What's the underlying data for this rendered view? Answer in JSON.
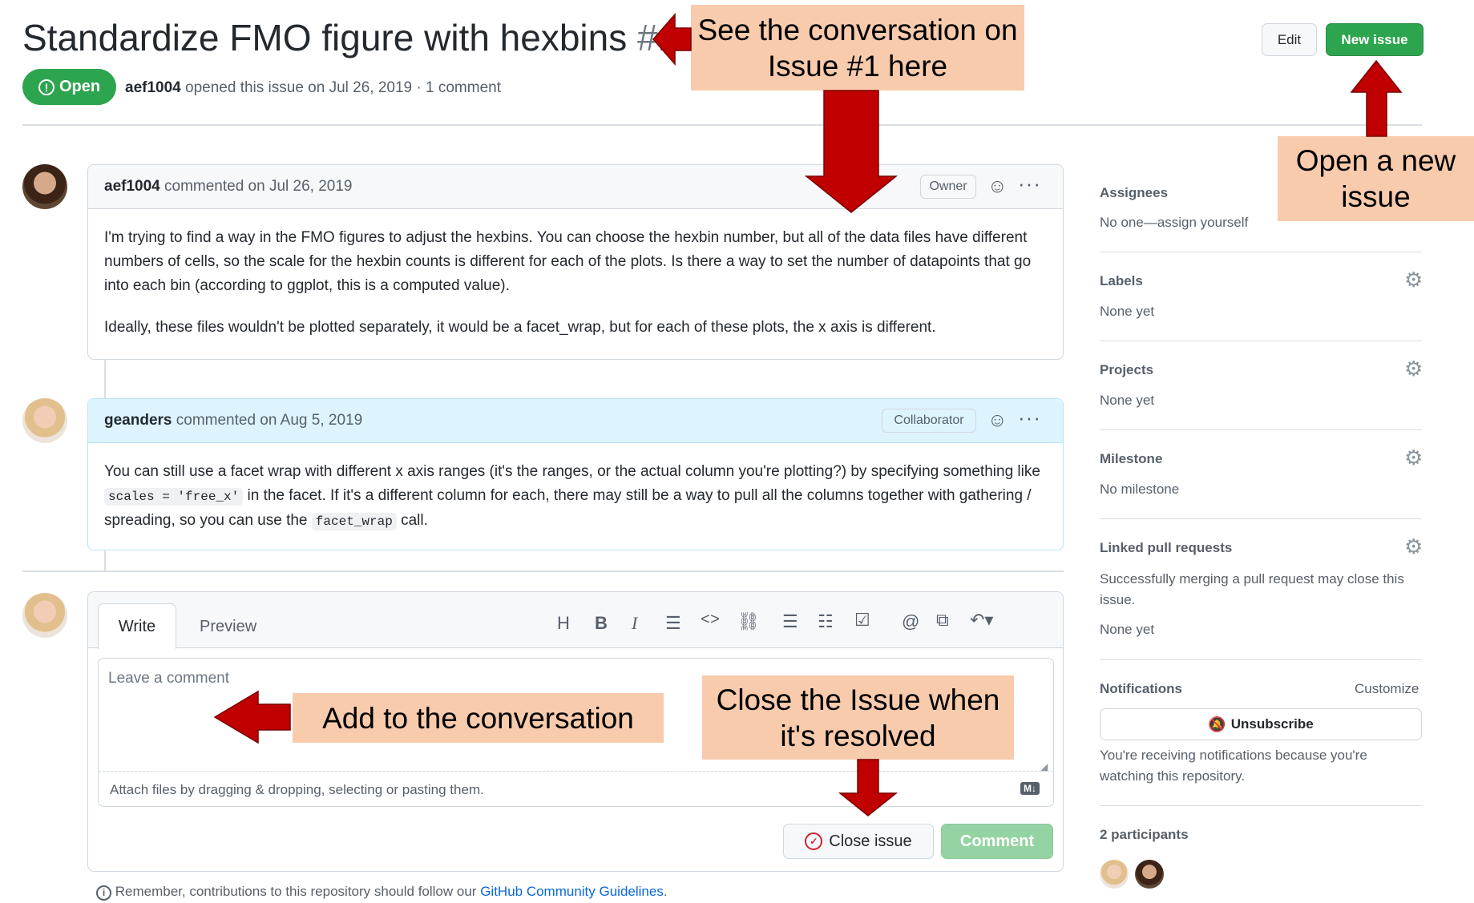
{
  "issue": {
    "title": "Standardize FMO figure with hexbins",
    "number": "#1",
    "status": "Open",
    "author": "aef1004",
    "opened_text": "opened this issue on Jul 26, 2019 · 1 comment"
  },
  "header_buttons": {
    "edit": "Edit",
    "new_issue": "New issue"
  },
  "comments": [
    {
      "author": "aef1004",
      "date_text": "commented on Jul 26, 2019",
      "role": "Owner",
      "paragraphs": [
        "I'm trying to find a way in the FMO figures to adjust the hexbins. You can choose the hexbin number, but all of the data files have different numbers of cells, so the scale for the hexbin counts is different for each of the plots. Is there a way to set the number of datapoints that go into each bin (according to ggplot, this is a computed value).",
        "Ideally, these files wouldn't be plotted separately, it would be a facet_wrap, but for each of these plots, the x axis is different."
      ]
    },
    {
      "author": "geanders",
      "date_text": "commented on Aug 5, 2019",
      "role": "Collaborator",
      "text_1": "You can still use a facet wrap with different x axis ranges (it's the ranges, or the actual column you're plotting?) by specifying something like",
      "code_1": "scales = 'free_x'",
      "text_2": "in the facet. If it's a different column for each, there may still be a way to pull all the columns together with gathering / spreading, so you can use the",
      "code_2": "facet_wrap",
      "text_3": "call."
    }
  ],
  "editor": {
    "tab_write": "Write",
    "tab_preview": "Preview",
    "toolbar": [
      "H",
      "B",
      "I",
      "quote",
      "code",
      "link",
      "bulleted-list",
      "numbered-list",
      "task-list",
      "mention",
      "reference",
      "reply"
    ],
    "placeholder": "Leave a comment",
    "attach_text": "Attach files by dragging & dropping, selecting or pasting them.",
    "close_button": "Close issue",
    "comment_button": "Comment",
    "guidelines_prefix": "Remember, contributions to this repository should follow our",
    "guidelines_link": "GitHub Community Guidelines",
    "guidelines_suffix": "."
  },
  "sidebar": {
    "assignees": {
      "heading": "Assignees",
      "value": "No one—assign yourself"
    },
    "labels": {
      "heading": "Labels",
      "value": "None yet"
    },
    "projects": {
      "heading": "Projects",
      "value": "None yet"
    },
    "milestone": {
      "heading": "Milestone",
      "value": "No milestone"
    },
    "linked_prs": {
      "heading": "Linked pull requests",
      "description": "Successfully merging a pull request may close this issue.",
      "value": "None yet"
    },
    "notifications": {
      "heading": "Notifications",
      "customize": "Customize",
      "unsubscribe": "Unsubscribe",
      "description": "You're receiving notifications because you're watching this repository."
    },
    "participants": {
      "heading": "2 participants"
    }
  },
  "callouts": {
    "conversation": "See the conversation on Issue #1 here",
    "new_issue": "Open a new issue",
    "add": "Add to the conversation",
    "close": "Close the Issue when it's resolved"
  },
  "colors": {
    "green": "#2da44e",
    "callout": "#f8cbad",
    "arrow": "#c00000",
    "link": "#0969da"
  }
}
